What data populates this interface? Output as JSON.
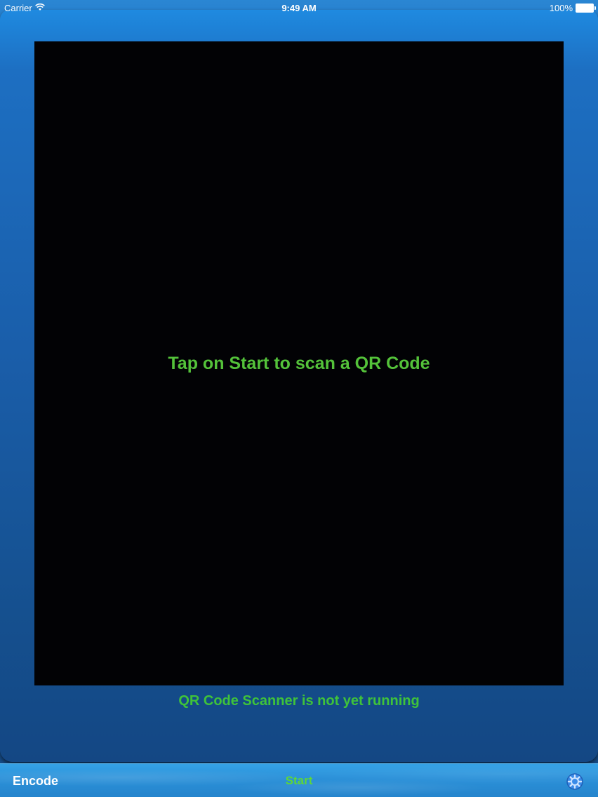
{
  "status_bar": {
    "carrier": "Carrier",
    "time": "9:49 AM",
    "battery": "100%"
  },
  "camera": {
    "hint": "Tap on Start to scan a QR Code"
  },
  "scanner_status": "QR Code Scanner is not yet running",
  "toolbar": {
    "encode_label": "Encode",
    "start_label": "Start",
    "settings_icon": "gear-icon"
  },
  "colors": {
    "accent_green": "#54c23a",
    "background_blue": "#1a5eaa",
    "toolbar_blue": "#2b91d9"
  }
}
